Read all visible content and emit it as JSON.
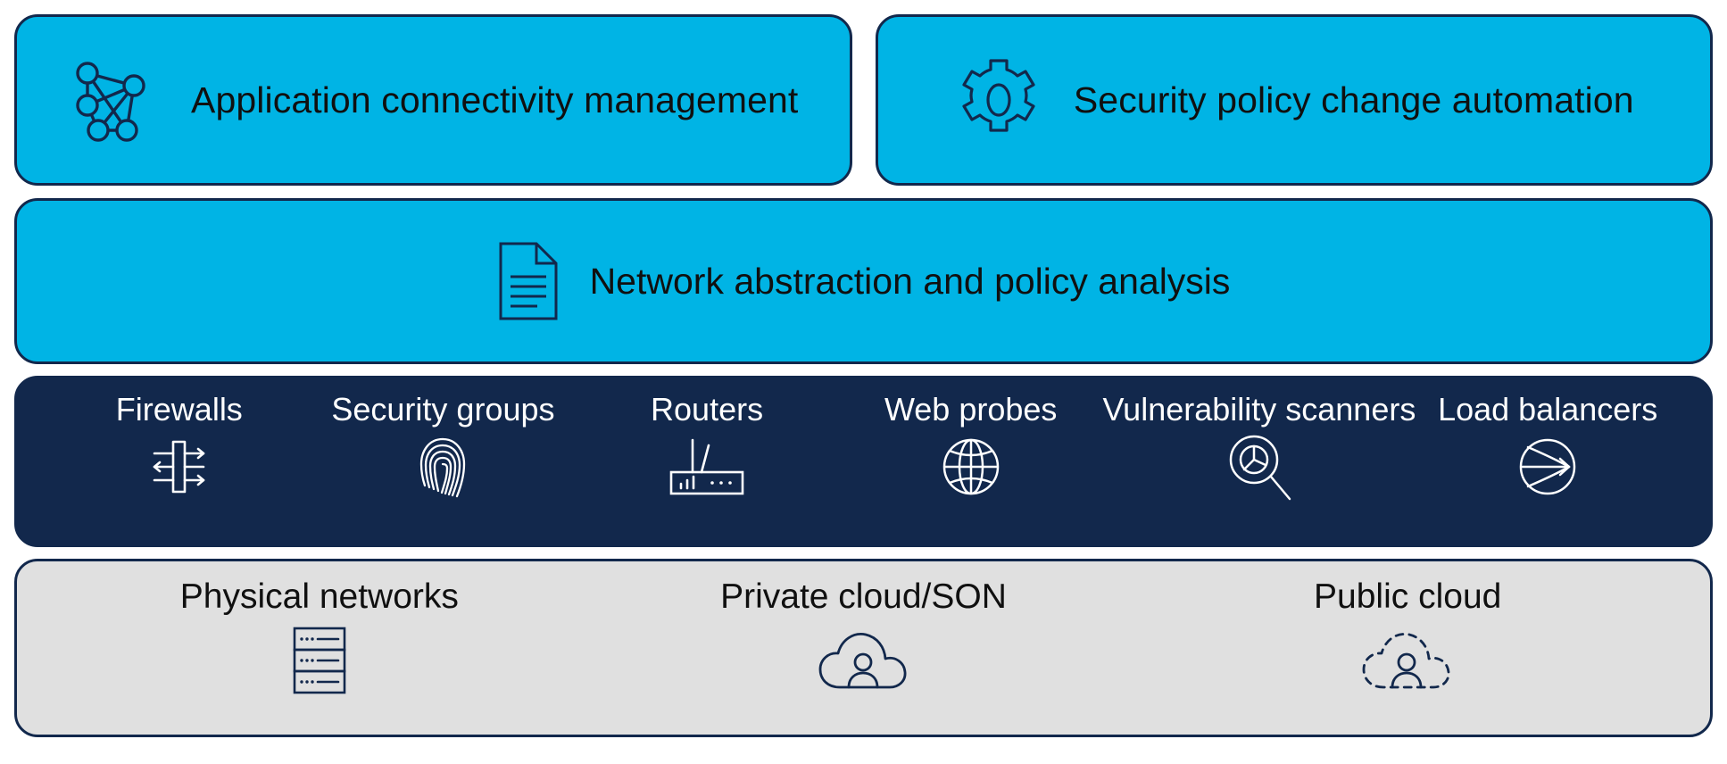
{
  "colors": {
    "accent_cyan": "#00B4E5",
    "navy": "#12284C",
    "light_gray": "#E0E0E0",
    "white": "#FFFFFF",
    "text_dark": "#101010"
  },
  "layers": {
    "top_row": [
      {
        "label": "Application connectivity management",
        "icon": "network-graph-icon"
      },
      {
        "label": "Security policy change automation",
        "icon": "gear-icon"
      }
    ],
    "abstraction_layer": {
      "label": "Network abstraction and policy analysis",
      "icon": "document-icon"
    },
    "services_layer": [
      {
        "label": "Firewalls",
        "icon": "firewall-icon"
      },
      {
        "label": "Security groups",
        "icon": "fingerprint-icon"
      },
      {
        "label": "Routers",
        "icon": "router-icon"
      },
      {
        "label": "Web probes",
        "icon": "globe-icon"
      },
      {
        "label": "Vulnerability scanners",
        "icon": "magnifier-pie-chart-icon"
      },
      {
        "label": "Load balancers",
        "icon": "load-balancer-arrow-icon"
      }
    ],
    "infrastructure_layer": [
      {
        "label": "Physical networks",
        "icon": "server-rack-icon"
      },
      {
        "label": "Private cloud/SON",
        "icon": "cloud-user-solid-icon"
      },
      {
        "label": "Public cloud",
        "icon": "cloud-user-dashed-icon"
      }
    ]
  }
}
